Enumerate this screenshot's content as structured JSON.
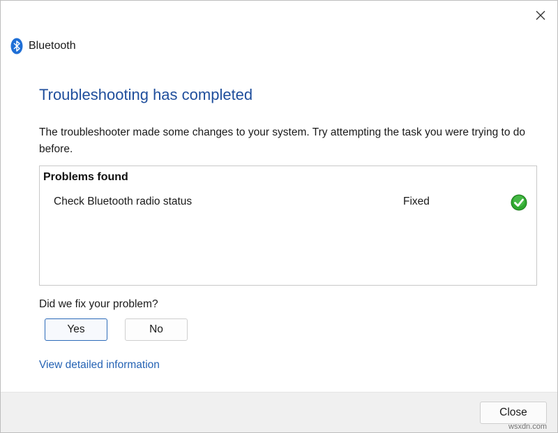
{
  "window": {
    "app_title": "Bluetooth",
    "close_icon": "close-icon"
  },
  "main": {
    "heading": "Troubleshooting has completed",
    "description": "The troubleshooter made some changes to your system. Try attempting the task you were trying to do before.",
    "problems": {
      "header": "Problems found",
      "items": [
        {
          "name": "Check Bluetooth radio status",
          "status": "Fixed",
          "status_icon": "check-icon"
        }
      ]
    },
    "question": "Did we fix your problem?",
    "yes_label": "Yes",
    "no_label": "No",
    "detail_link": "View detailed information"
  },
  "footer": {
    "close_label": "Close"
  },
  "watermark": "wsxdn.com",
  "colors": {
    "heading": "#1f4e9c",
    "link": "#2563b4",
    "accent_border": "#2d6bb9",
    "footer_bg": "#f0f0f0",
    "success": "#2fa82f"
  }
}
